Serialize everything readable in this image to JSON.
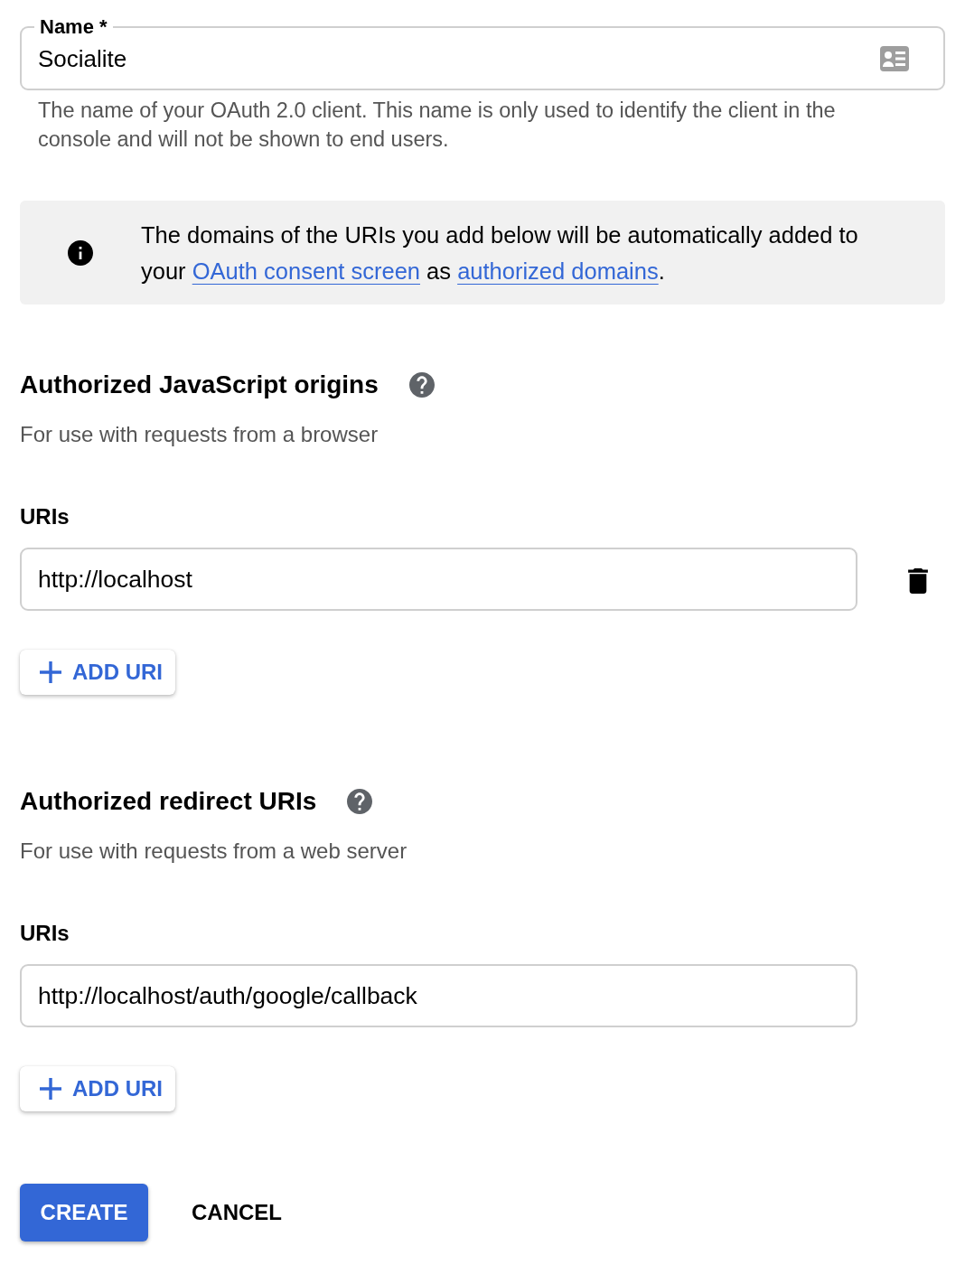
{
  "name_field": {
    "label": "Name *",
    "value": "Socialite",
    "helper": "The name of your OAuth 2.0 client. This name is only used to identify the client in the console and will not be shown to end users."
  },
  "info_banner": {
    "parts": [
      {
        "kind": "text",
        "text": "The domains of the URIs you add below will be automatically added to your "
      },
      {
        "kind": "link",
        "text": "OAuth consent screen"
      },
      {
        "kind": "text",
        "text": " as "
      },
      {
        "kind": "link",
        "text": "authorized domains"
      },
      {
        "kind": "text",
        "text": "."
      }
    ]
  },
  "sections": [
    {
      "title": "Authorized JavaScript origins",
      "subtitle": "For use with requests from a browser",
      "uris_label": "URIs",
      "uris": [
        {
          "value": "http://localhost",
          "removable": true
        }
      ],
      "add_button": "ADD URI"
    },
    {
      "title": "Authorized redirect URIs",
      "subtitle": "For use with requests from a web server",
      "uris_label": "URIs",
      "uris": [
        {
          "value": "http://localhost/auth/google/callback",
          "removable": false
        }
      ],
      "add_button": "ADD URI"
    }
  ],
  "actions": [
    {
      "label": "CREATE",
      "kind": "primary"
    },
    {
      "label": "CANCEL",
      "kind": "text"
    }
  ]
}
